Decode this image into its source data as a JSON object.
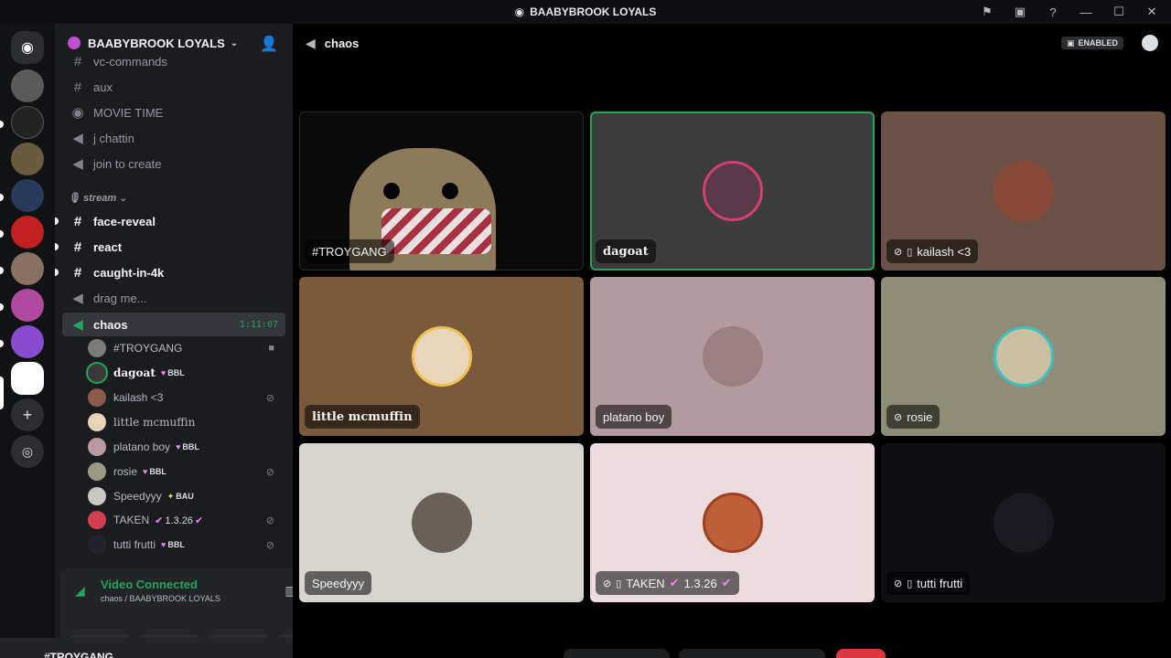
{
  "window": {
    "title": "BAABYBROOK LOYALS"
  },
  "guild": {
    "name": "BAABYBROOK LOYALS"
  },
  "channels": {
    "items": [
      {
        "label": "vc-commands",
        "icon": "hash-icon",
        "style": "dim"
      },
      {
        "label": "aux",
        "icon": "hash-icon",
        "style": "dim"
      },
      {
        "label": "MOVIE TIME",
        "icon": "stage-icon",
        "style": "dim"
      },
      {
        "label": "j chattin",
        "icon": "speaker-icon",
        "style": "dim"
      },
      {
        "label": "join to create",
        "icon": "speaker-icon",
        "style": "dim"
      }
    ],
    "category": "stream",
    "stream_items": [
      {
        "label": "face-reveal",
        "icon": "hash-icon"
      },
      {
        "label": "react",
        "icon": "hash-icon"
      },
      {
        "label": "caught-in-4k",
        "icon": "hash-icon"
      },
      {
        "label": "drag me...",
        "icon": "speaker-icon"
      }
    ],
    "active": {
      "label": "chaos",
      "timer": "1:11:07"
    }
  },
  "voice_members": [
    {
      "name": "#TROYGANG",
      "tag": "",
      "right_icon": "camera-icon",
      "color": "#7a7a7a"
    },
    {
      "name": "dagoat",
      "tag": "BBL",
      "right_icon": "",
      "color": "#3a3a3a"
    },
    {
      "name": "kailash <3",
      "tag": "",
      "right_icon": "mic-muted-icon",
      "color": "#8a5a4a"
    },
    {
      "name": "little mcmuffin",
      "tag": "",
      "right_icon": "",
      "color": "#e8d4b8"
    },
    {
      "name": "platano boy",
      "tag": "BBL",
      "right_icon": "",
      "color": "#b89aa0"
    },
    {
      "name": "rosie",
      "tag": "BBL",
      "right_icon": "mic-muted-icon",
      "color": "#9a9a80"
    },
    {
      "name": "Speedyyy",
      "tag": "BAU",
      "right_icon": "",
      "color": "#c8c8c0"
    },
    {
      "name": "TAKEN",
      "tag": "1.3.26",
      "right_icon": "deafened-icon",
      "color": "#d04050"
    },
    {
      "name": "tutti frutti",
      "tag": "BBL",
      "right_icon": "mic-muted-icon",
      "color": "#222230"
    }
  ],
  "voice_panel": {
    "status": "Video Connected",
    "location": "chaos / BAABYBROOK LOYALS",
    "user": "#TROYGANG"
  },
  "stage": {
    "channel": "chaos",
    "badge": "ENABLED"
  },
  "tiles": [
    {
      "name": "#TROYGANG",
      "bg": "#0a0a0a",
      "avatar": "",
      "icons": [],
      "speaking": false,
      "video": true
    },
    {
      "name": "dagoat",
      "bg": "#3c3c3c",
      "avatar": "#5a3a4a",
      "icons": [],
      "speaking": true,
      "video": false
    },
    {
      "name": "kailash <3",
      "bg": "#6b5146",
      "avatar": "#8a4a3a",
      "icons": [
        "mic-muted-icon",
        "mobile-icon"
      ],
      "speaking": false,
      "video": false
    },
    {
      "name": "little mcmuffin",
      "bg": "#7a5a3c",
      "avatar": "#e8d4b8",
      "icons": [],
      "speaking": false,
      "video": false
    },
    {
      "name": "platano boy",
      "bg": "#b39a9e",
      "avatar": "#9a8080",
      "icons": [],
      "speaking": false,
      "video": false
    },
    {
      "name": "rosie",
      "bg": "#8f8d78",
      "avatar": "#c8c0a0",
      "icons": [
        "mic-muted-icon"
      ],
      "speaking": false,
      "video": false
    },
    {
      "name": "Speedyyy",
      "bg": "#d8d5d0",
      "avatar": "#6a6058",
      "icons": [],
      "speaking": false,
      "video": false
    },
    {
      "name": "TAKEN",
      "tag": "1.3.26",
      "bg": "#ecdcdf",
      "avatar": "#c0603a",
      "icons": [
        "deafened-icon",
        "mobile-icon"
      ],
      "speaking": false,
      "video": false
    },
    {
      "name": "tutti frutti",
      "bg": "#0f0e12",
      "avatar": "#1a1820",
      "icons": [
        "mic-muted-icon",
        "mobile-icon"
      ],
      "speaking": false,
      "video": false
    }
  ],
  "colors": {
    "accent_green": "#23a55a",
    "sidebar": "#1b1c20",
    "rail": "#111214"
  }
}
